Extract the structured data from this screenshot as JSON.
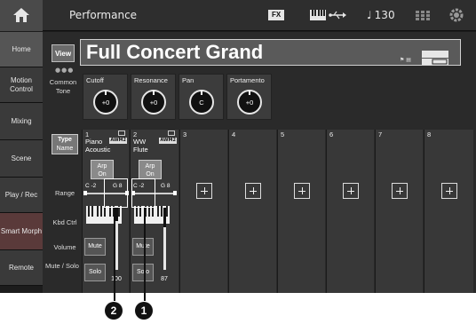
{
  "header": {
    "title": "Performance",
    "fx_badge": "FX",
    "tempo_value": "130"
  },
  "sidebar": {
    "items": [
      {
        "label": "Home"
      },
      {
        "label": "Motion Control"
      },
      {
        "label": "Mixing"
      },
      {
        "label": "Scene"
      },
      {
        "label": "Play / Rec"
      },
      {
        "label": "Smart Morph"
      },
      {
        "label": "Remote"
      }
    ]
  },
  "main": {
    "view_label": "View",
    "performance_name": "Full Concert Grand",
    "common_tone_label": "Common Tone",
    "knobs": [
      {
        "label": "Cutoff",
        "value": "+0"
      },
      {
        "label": "Resonance",
        "value": "+0"
      },
      {
        "label": "Pan",
        "value": "C"
      },
      {
        "label": "Portamento",
        "value": "+0"
      }
    ],
    "type_label": "Type",
    "name_label": "Name",
    "row_labels": {
      "range": "Range",
      "kbd_ctrl": "Kbd Ctrl",
      "volume": "Volume",
      "mute_solo": "Mute / Solo"
    }
  },
  "parts": [
    {
      "number": "1",
      "inst_line1": "Piano",
      "inst_line2": "Acoustic",
      "badge": "AWM2",
      "arp_label1": "Arp",
      "arp_label2": "On",
      "range_low": "C -2",
      "range_high": "G 8",
      "mute_label": "Mute",
      "solo_label": "Solo",
      "volume": "100",
      "volume_level": 0.79
    },
    {
      "number": "2",
      "inst_line1": "WW",
      "inst_line2": "Flute",
      "badge": "AWM2",
      "arp_label1": "Arp",
      "arp_label2": "On",
      "range_low": "C -2",
      "range_high": "G 8",
      "mute_label": "Mute",
      "solo_label": "Solo",
      "volume": "87",
      "volume_level": 0.69
    },
    {
      "number": "3"
    },
    {
      "number": "4"
    },
    {
      "number": "5"
    },
    {
      "number": "6"
    },
    {
      "number": "7"
    },
    {
      "number": "8"
    }
  ],
  "callouts": [
    {
      "label": "2"
    },
    {
      "label": "1"
    }
  ],
  "colors": {
    "screen_bg": "#1c1c1c",
    "panel_bg": "#2a2a2a",
    "name_field_bg": "#5a5a5a",
    "callout_bg": "#111111"
  }
}
